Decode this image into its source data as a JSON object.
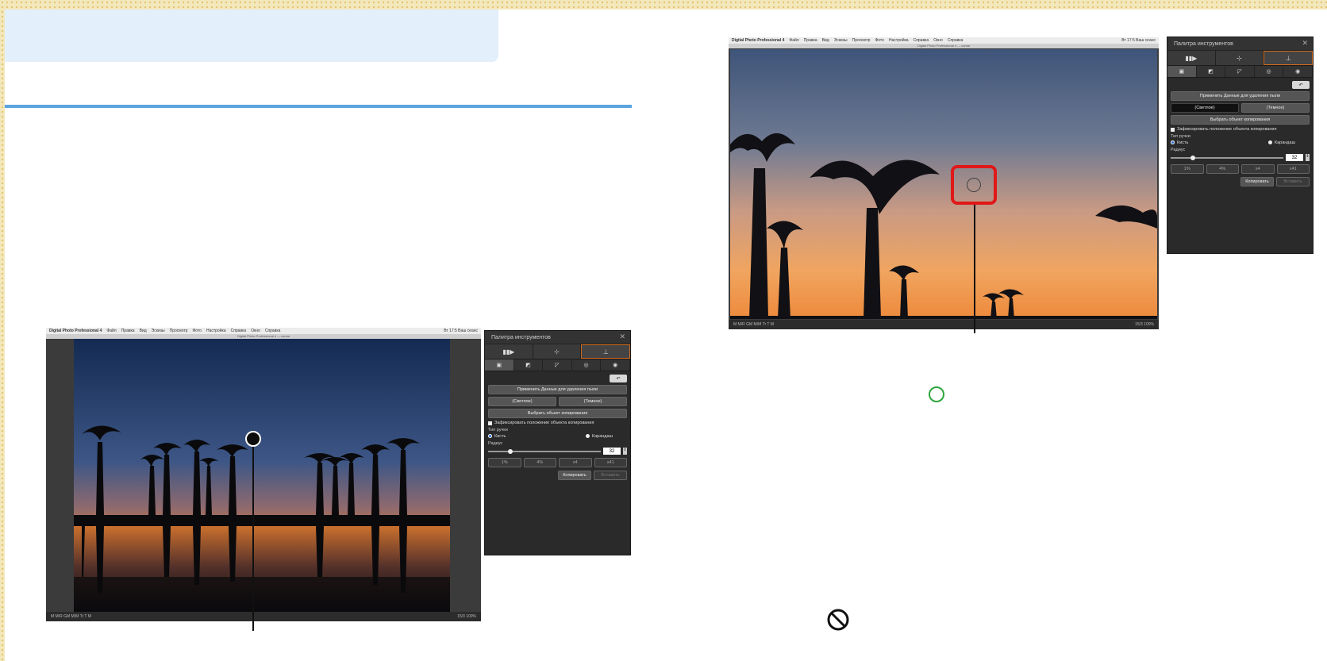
{
  "colors": {
    "frame": "#f3e7bc",
    "title_box": "#e3effb",
    "rule": "#5aa4e0",
    "highlight": "#e01818",
    "ok_circle": "#2ea53c",
    "palette_bg": "#2a2a2a",
    "active_tab_border": "#d06a1c"
  },
  "icons": {
    "ok": "green-circle-icon",
    "not_allowed": "prohibited-icon",
    "undo": "undo-arrow-icon",
    "close": "close-icon"
  },
  "app_left": {
    "menubar": {
      "app_name": "Digital Photo Professional 4",
      "menus": [
        "Файл",
        "Правка",
        "Вид",
        "Эскизы",
        "Просмотр",
        "Фото",
        "Настройка",
        "Справка",
        "Окно",
        "Справка"
      ],
      "right_text": "Вт 17:5 Ваш сеанс"
    },
    "subtitle": "Digital Photo Professional 4 — копия",
    "status_left": "M  M/R  GM  M/M  Tr  T  M",
    "status_right": "15/3  100%"
  },
  "app_right": {
    "menubar": {
      "app_name": "Digital Photo Professional 4",
      "menus": [
        "Файл",
        "Правка",
        "Вид",
        "Эскизы",
        "Просмотр",
        "Фото",
        "Настройка",
        "Справка",
        "Окно",
        "Справка"
      ],
      "right_text": "Вт 17:5 Ваш сеанс"
    },
    "subtitle": "Digital Photo Professional 4 — копия",
    "status_left": "M  M/R  GM  M/M  Tr  T  M",
    "status_right": "15/3  100%"
  },
  "palette": {
    "title": "Палитра инструментов",
    "close_glyph": "✕",
    "tabs": [
      "▮▮▶",
      "⊹",
      "⊥"
    ],
    "subtabs": [
      "▣",
      "◩",
      "◸",
      "◎",
      "◉"
    ],
    "undo_glyph": "↶",
    "apply_dust_data": "Применить Данные для удаления пыли",
    "light": "(Светлое)",
    "dark": "(Темное)",
    "select_copy_source": "Выбрать объект копирования",
    "fix_copy_position": "Зафиксировать положение объекта копирования",
    "pen_type_label": "Тип ручки",
    "brush": "Кисть",
    "pencil": "Карандаш",
    "radius_label": "Радиус",
    "radius_value": "32",
    "spin_glyph": "⇕",
    "radius_fraction": 0.2,
    "preset_buttons": [
      "1%",
      "4%",
      "x4",
      "x41"
    ],
    "copy_button": "Копировать",
    "paste_button": "Вставить"
  }
}
